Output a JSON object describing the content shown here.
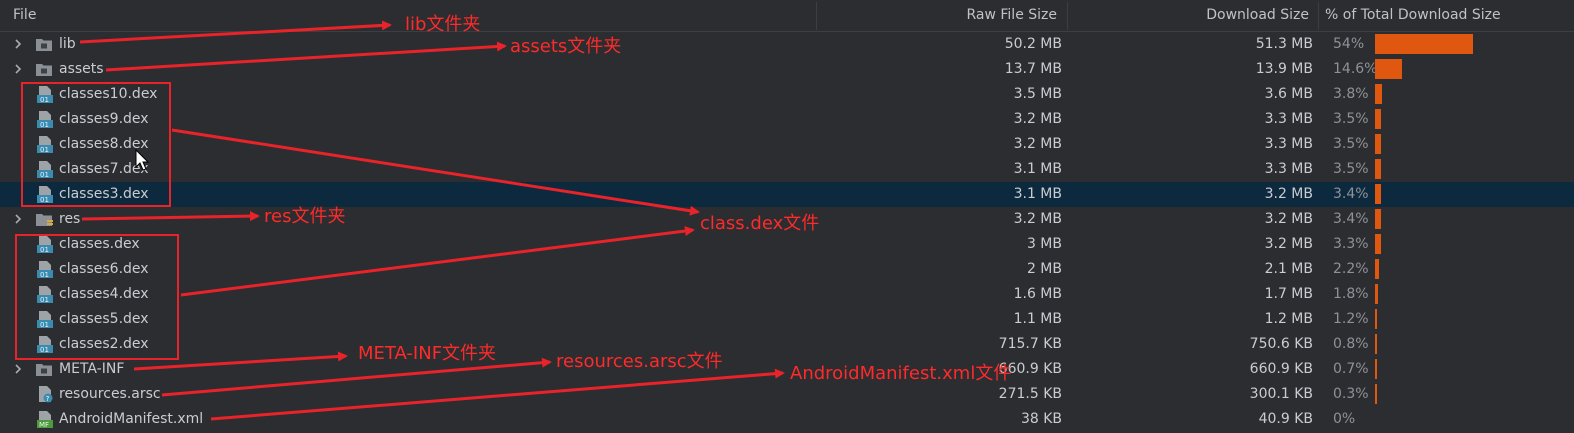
{
  "header": {
    "file": "File",
    "raw": "Raw File Size",
    "download": "Download Size",
    "percent": "% of Total Download Size"
  },
  "rows": [
    {
      "name": "lib",
      "kind": "folder",
      "raw": "50.2 MB",
      "download": "51.3 MB",
      "percent": "54%",
      "fraction": 0.54
    },
    {
      "name": "assets",
      "kind": "folder",
      "raw": "13.7 MB",
      "download": "13.9 MB",
      "percent": "14.6%",
      "fraction": 0.146
    },
    {
      "name": "classes10.dex",
      "kind": "dex",
      "raw": "3.5 MB",
      "download": "3.6 MB",
      "percent": "3.8%",
      "fraction": 0.038
    },
    {
      "name": "classes9.dex",
      "kind": "dex",
      "raw": "3.2 MB",
      "download": "3.3 MB",
      "percent": "3.5%",
      "fraction": 0.035
    },
    {
      "name": "classes8.dex",
      "kind": "dex",
      "raw": "3.2 MB",
      "download": "3.3 MB",
      "percent": "3.5%",
      "fraction": 0.035
    },
    {
      "name": "classes7.dex",
      "kind": "dex",
      "raw": "3.1 MB",
      "download": "3.3 MB",
      "percent": "3.5%",
      "fraction": 0.035
    },
    {
      "name": "classes3.dex",
      "kind": "dex",
      "raw": "3.1 MB",
      "download": "3.2 MB",
      "percent": "3.4%",
      "fraction": 0.034,
      "selected": true
    },
    {
      "name": "res",
      "kind": "res",
      "raw": "3.2 MB",
      "download": "3.2 MB",
      "percent": "3.4%",
      "fraction": 0.034
    },
    {
      "name": "classes.dex",
      "kind": "dex",
      "raw": "3 MB",
      "download": "3.2 MB",
      "percent": "3.3%",
      "fraction": 0.033
    },
    {
      "name": "classes6.dex",
      "kind": "dex",
      "raw": "2 MB",
      "download": "2.1 MB",
      "percent": "2.2%",
      "fraction": 0.022
    },
    {
      "name": "classes4.dex",
      "kind": "dex",
      "raw": "1.6 MB",
      "download": "1.7 MB",
      "percent": "1.8%",
      "fraction": 0.018
    },
    {
      "name": "classes5.dex",
      "kind": "dex",
      "raw": "1.1 MB",
      "download": "1.2 MB",
      "percent": "1.2%",
      "fraction": 0.012
    },
    {
      "name": "classes2.dex",
      "kind": "dex",
      "raw": "715.7 KB",
      "download": "750.6 KB",
      "percent": "0.8%",
      "fraction": 0.008
    },
    {
      "name": "META-INF",
      "kind": "folder",
      "raw": "660.9 KB",
      "download": "660.9 KB",
      "percent": "0.7%",
      "fraction": 0.007
    },
    {
      "name": "resources.arsc",
      "kind": "arsc",
      "raw": "271.5 KB",
      "download": "300.1 KB",
      "percent": "0.3%",
      "fraction": 0.003
    },
    {
      "name": "AndroidManifest.xml",
      "kind": "manifest",
      "raw": "38 KB",
      "download": "40.9 KB",
      "percent": "0%",
      "fraction": 0.0
    }
  ],
  "annotations": {
    "lib": "lib文件夹",
    "assets": "assets文件夹",
    "res": "res文件夹",
    "dex": "class.dex文件",
    "metainf": "META-INF文件夹",
    "arsc": "resources.arsc文件",
    "manifest": "AndroidManifest.xml文件"
  },
  "icons": {
    "chevron": "chevron-right-icon",
    "folder": "folder-icon",
    "dex": "dex-file-icon",
    "res": "res-folder-icon",
    "arsc": "arsc-file-icon",
    "manifest": "manifest-file-icon"
  },
  "colors": {
    "bar": "#e0570f",
    "selected_row": "#0d293e",
    "annotation": "#ff2a2a"
  }
}
